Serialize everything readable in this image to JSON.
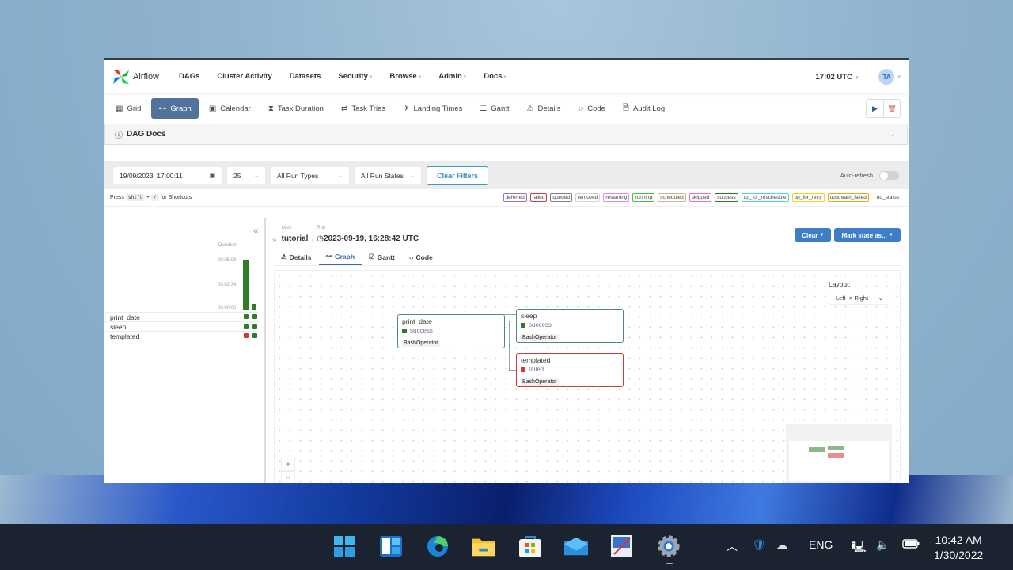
{
  "app": {
    "name": "Airflow"
  },
  "topnav": {
    "items": [
      {
        "label": "DAGs",
        "has_caret": false
      },
      {
        "label": "Cluster Activity",
        "has_caret": false
      },
      {
        "label": "Datasets",
        "has_caret": false
      },
      {
        "label": "Security",
        "has_caret": true
      },
      {
        "label": "Browse",
        "has_caret": true
      },
      {
        "label": "Admin",
        "has_caret": true
      },
      {
        "label": "Docs",
        "has_caret": true
      }
    ],
    "time": "17:02 UTC",
    "user_initials": "TA"
  },
  "view_tabs": [
    {
      "label": "Grid",
      "icon": "grid-icon",
      "active": false
    },
    {
      "label": "Graph",
      "icon": "graph-icon",
      "active": true
    },
    {
      "label": "Calendar",
      "icon": "calendar-icon",
      "active": false
    },
    {
      "label": "Task Duration",
      "icon": "hourglass-icon",
      "active": false
    },
    {
      "label": "Task Tries",
      "icon": "repeat-icon",
      "active": false
    },
    {
      "label": "Landing Times",
      "icon": "plane-landing-icon",
      "active": false
    },
    {
      "label": "Gantt",
      "icon": "gantt-icon",
      "active": false
    },
    {
      "label": "Details",
      "icon": "warning-triangle-icon",
      "active": false
    },
    {
      "label": "Code",
      "icon": "code-icon",
      "active": false
    },
    {
      "label": "Audit Log",
      "icon": "file-search-icon",
      "active": false
    }
  ],
  "dag_docs": {
    "label": "DAG Docs"
  },
  "filters": {
    "base_date": "19/09/2023, 17:00:11",
    "num_runs": "25",
    "run_types": "All Run Types",
    "run_states": "All Run States",
    "clear_label": "Clear Filters",
    "auto_refresh_label": "Auto-refresh",
    "auto_refresh_on": false
  },
  "shortcuts": {
    "press": "Press",
    "key1": "shift",
    "plus": "+",
    "key2": "/",
    "suffix": "for Shortcuts"
  },
  "states": [
    {
      "label": "deferred",
      "color": "#9370db"
    },
    {
      "label": "failed",
      "color": "#dc3545"
    },
    {
      "label": "queued",
      "color": "#808080"
    },
    {
      "label": "removed",
      "color": "#d3d3d3"
    },
    {
      "label": "restarting",
      "color": "#ee82ee"
    },
    {
      "label": "running",
      "color": "#32cd32"
    },
    {
      "label": "scheduled",
      "color": "#d2b48c"
    },
    {
      "label": "skipped",
      "color": "#ff69b4"
    },
    {
      "label": "success",
      "color": "#2f7d27"
    },
    {
      "label": "up_for_reschedule",
      "color": "#40e0d0"
    },
    {
      "label": "up_for_retry",
      "color": "#ffd700"
    },
    {
      "label": "upstream_failed",
      "color": "#ffa500"
    },
    {
      "label": "no_status",
      "color": null
    }
  ],
  "grid": {
    "duration_label": "Duration",
    "ticks": [
      "00:05:08",
      "00:02:34",
      "00:00:00"
    ],
    "tasks": [
      {
        "name": "print_date",
        "states": [
          "success",
          "success"
        ]
      },
      {
        "name": "sleep",
        "states": [
          "success",
          "success"
        ]
      },
      {
        "name": "templated",
        "states": [
          "failed",
          "success"
        ]
      }
    ]
  },
  "breadcrumb": {
    "dag_label": "DAG",
    "dag_value": "tutorial",
    "run_label": "Run",
    "run_value": "2023-09-19, 16:28:42 UTC"
  },
  "actions": {
    "clear": "Clear",
    "mark_state": "Mark state as..."
  },
  "sub_tabs": [
    {
      "label": "Details",
      "icon": "warning-triangle-icon",
      "active": false
    },
    {
      "label": "Graph",
      "icon": "graph-icon",
      "active": true
    },
    {
      "label": "Gantt",
      "icon": "gantt-icon",
      "active": false
    },
    {
      "label": "Code",
      "icon": "code-icon",
      "active": false
    }
  ],
  "graph": {
    "layout_label": "Layout:",
    "layout_value": "Left -> Right",
    "nodes": [
      {
        "name": "print_date",
        "state": "success",
        "operator": "BashOperator"
      },
      {
        "name": "sleep",
        "state": "success",
        "operator": "BashOperator"
      },
      {
        "name": "templated",
        "state": "failed",
        "operator": "BashOperator"
      }
    ],
    "edges": [
      [
        "print_date",
        "sleep"
      ],
      [
        "print_date",
        "templated"
      ]
    ],
    "zoom_in": "+",
    "zoom_out": "−"
  },
  "colors": {
    "success": "#2f7d27",
    "failed": "#dc3535",
    "accent": "#3d7dc9",
    "active_tab": "#51729b"
  },
  "taskbar": {
    "apps": [
      "windows-start",
      "widgets",
      "edge",
      "file-explorer",
      "store",
      "mail",
      "paint",
      "settings"
    ],
    "language": "ENG",
    "time": "10:42 AM",
    "date": "1/30/2022"
  }
}
